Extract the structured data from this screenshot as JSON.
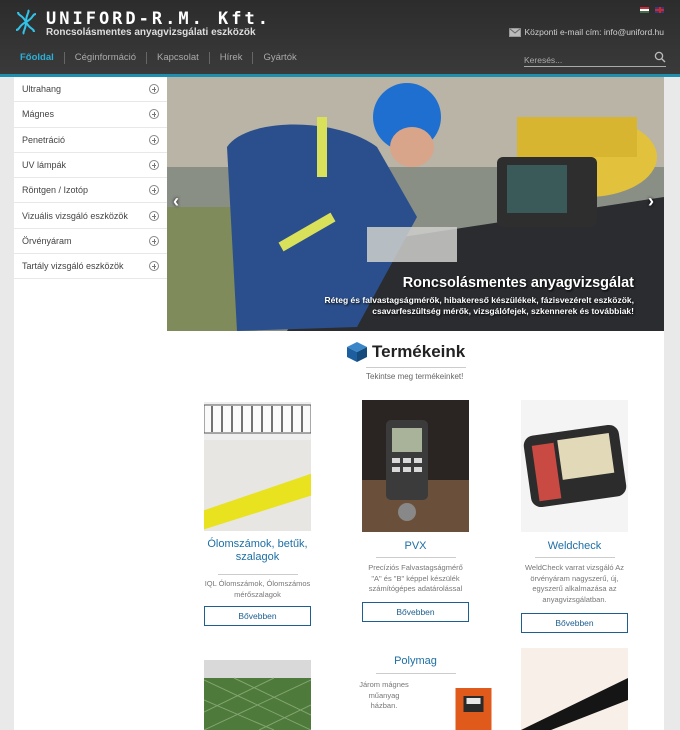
{
  "header": {
    "brand": "UNIFORD-R.M. Kft.",
    "tagline": "Roncsolásmentes anyagvizsgálati eszközök",
    "email_text": "Központi e-mail cím: info@uniford.hu",
    "search_placeholder": "Keresés...",
    "accent": "#1f8fb0"
  },
  "nav": {
    "items": [
      "Főoldal",
      "Céginformáció",
      "Kapcsolat",
      "Hírek",
      "Gyártók"
    ],
    "active_index": 0
  },
  "sidebar": {
    "items": [
      "Ultrahang",
      "Mágnes",
      "Penetráció",
      "UV lámpák",
      "Röntgen / Izotóp",
      "Vizuális vizsgáló eszközök",
      "Örvényáram",
      "Tartály vizsgáló eszközök"
    ]
  },
  "hero": {
    "title": "Roncsolásmentes anyagvizsgálat",
    "subtitle": "Réteg és falvastagságmérők, hibakereső készülékek, fázisvezérelt eszközök, csavarfeszültség mérők, vizsgálófejek, szkennerek és továbbiak!"
  },
  "products_section": {
    "title": "Termékeink",
    "subtitle": "Tekintse meg termékeinket!"
  },
  "products": [
    {
      "title": "Ólomszámok, betűk, szalagok",
      "desc": "IQL Ólomszámok, Ólomszámos mérőszalagok",
      "button": "Bővebben"
    },
    {
      "title": "PVX",
      "desc": "Precíziós Falvastagságmérő \"A\" és \"B\" képpel készülék számítógépes adatárolással",
      "button": "Bővebben"
    },
    {
      "title": "Weldcheck",
      "desc": "WeldCheck varrat vizsgáló Az örvényáram nagyszerű, új, egyszerű alkalmazása az anyagvizsgálatban.",
      "button": "Bővebben"
    },
    {
      "title": "Polymag",
      "desc": "Járom mágnes műanyag házban."
    }
  ]
}
